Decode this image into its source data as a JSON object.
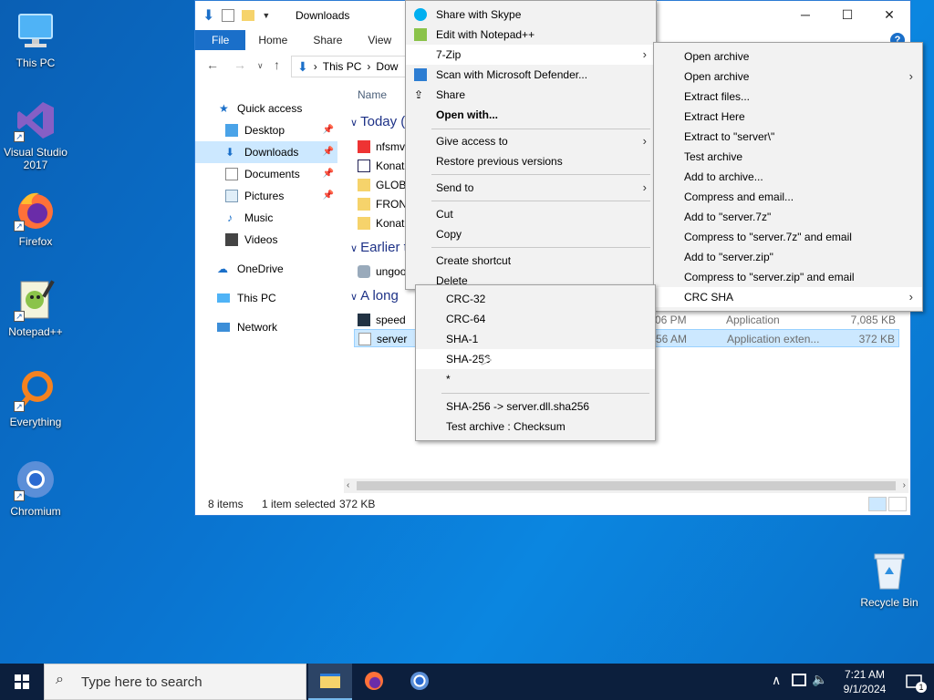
{
  "desktop": {
    "icons": [
      {
        "label": "This PC",
        "icon": "this-pc-icon"
      },
      {
        "label": "Visual Studio 2017",
        "icon": "visual-studio-icon"
      },
      {
        "label": "Firefox",
        "icon": "firefox-icon"
      },
      {
        "label": "Notepad++",
        "icon": "notepadpp-icon"
      },
      {
        "label": "Everything",
        "icon": "everything-icon"
      },
      {
        "label": "Chromium",
        "icon": "chromium-icon"
      },
      {
        "label": "Recycle Bin",
        "icon": "recycle-bin-icon"
      }
    ]
  },
  "explorer": {
    "title": "Downloads",
    "ribbon_tabs": [
      "File",
      "Home",
      "Share",
      "View"
    ],
    "address": {
      "segment1": "This PC",
      "segment2": "Dow"
    },
    "nav": {
      "quick_access": "Quick access",
      "desktop": "Desktop",
      "downloads": "Downloads",
      "documents": "Documents",
      "pictures": "Pictures",
      "music": "Music",
      "videos": "Videos",
      "onedrive": "OneDrive",
      "this_pc": "This PC",
      "network": "Network"
    },
    "column_name": "Name",
    "groups": {
      "today": "Today (",
      "earlier": "Earlier t",
      "long_ago": "A long"
    },
    "files": [
      {
        "name": "nfsmv"
      },
      {
        "name": "Konat"
      },
      {
        "name": "GLOB/"
      },
      {
        "name": "FRON"
      },
      {
        "name": "Konat"
      },
      {
        "name": "ungoo"
      },
      {
        "name": "speed",
        "date": "06 PM",
        "type": "Application",
        "size": "7,085 KB"
      },
      {
        "name": "server",
        "date": "56 AM",
        "type": "Application exten...",
        "size": "372 KB"
      }
    ],
    "status": {
      "items": "8 items",
      "selected": "1 item selected",
      "size": "372 KB"
    }
  },
  "context_menu": {
    "items": {
      "skype": "Share with Skype",
      "notepad": "Edit with Notepad++",
      "sevenzip": "7-Zip",
      "defender": "Scan with Microsoft Defender...",
      "share": "Share",
      "open_with": "Open with...",
      "give_access": "Give access to",
      "restore": "Restore previous versions",
      "send_to": "Send to",
      "cut": "Cut",
      "copy": "Copy",
      "create_shortcut": "Create shortcut",
      "delete": "Delete"
    }
  },
  "sevenzip_menu": {
    "items": [
      "Open archive",
      "Open archive",
      "Extract files...",
      "Extract Here",
      "Extract to \"server\\\"",
      "Test archive",
      "Add to archive...",
      "Compress and email...",
      "Add to \"server.7z\"",
      "Compress to \"server.7z\" and email",
      "Add to \"server.zip\"",
      "Compress to \"server.zip\" and email",
      "CRC SHA"
    ]
  },
  "crc_menu": {
    "items": [
      "CRC-32",
      "CRC-64",
      "SHA-1",
      "SHA-256",
      "*"
    ],
    "items2": [
      "SHA-256 -> server.dll.sha256",
      "Test archive : Checksum"
    ]
  },
  "taskbar": {
    "search_placeholder": "Type here to search",
    "time": "7:21 AM",
    "date": "9/1/2024",
    "notification_count": "1"
  },
  "colors": {
    "accent": "#1a6fc9",
    "selection": "#cce8ff",
    "taskbar": "#0c1f3d"
  }
}
